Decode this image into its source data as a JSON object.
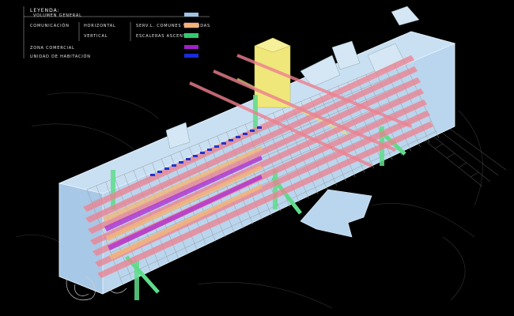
{
  "legend": {
    "title": "LEYENDA:",
    "items": [
      {
        "label": "VOLUMEN GENERAL",
        "color": "#9fc3e6"
      },
      {
        "label": "COMUNICACIÓN",
        "color": ""
      },
      {
        "label": "HORIZONTAL",
        "color": ""
      },
      {
        "label": "SERV.L. COMUNES VIVIENDAS",
        "color": "#e8a0a0"
      },
      {
        "label": "VERTICAL",
        "color": ""
      },
      {
        "label": "ESCALERAS ASCENSOR",
        "color": "#4fd27a"
      },
      {
        "label": "ZONA COMERCIAL",
        "color": "#a020c8"
      },
      {
        "label": "UNIDAD DE HABITACIÓN",
        "color": "#2030d0"
      }
    ],
    "swatches": {
      "volumen": "#9fc3e6",
      "servicios": "#f4b27a",
      "escaleras": "#2ecc71",
      "comercial": "#a020c8",
      "habitacion": "#1a2bd8"
    }
  },
  "colors": {
    "background": "#000000",
    "volume": "#b7d4ec",
    "volume_edge": "#e9f3fb",
    "structure": "#c8c8c8",
    "corridor": "#ee7f8e",
    "stair": "#5fdc8a",
    "core": "#e8e07a",
    "commercial": "#b02fd0",
    "units": "#2233cc",
    "terrain": "#3a3a3a"
  }
}
